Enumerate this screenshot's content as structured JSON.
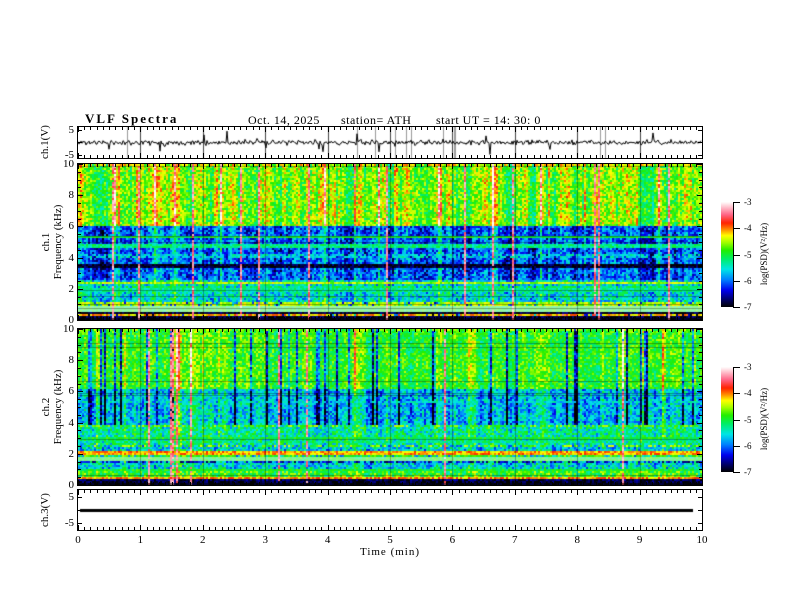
{
  "title": {
    "main": "VLF  Spectra",
    "date": "Oct. 14, 2025",
    "station": "station= ATH",
    "start_ut": "start UT =  14: 30: 0"
  },
  "x_axis": {
    "label": "Time  (min)",
    "range": [
      0,
      10
    ],
    "major_ticks": [
      "0",
      "1",
      "2",
      "3",
      "4",
      "5",
      "6",
      "7",
      "8",
      "9",
      "10"
    ],
    "minor_step": 0.1
  },
  "panels": {
    "wave1": {
      "ylabel": "ch.1(V)",
      "ytick_top": "5",
      "ytick_bottom": "-5",
      "yrange": [
        -5,
        5
      ]
    },
    "spec1": {
      "ylabel_ch": "ch.1",
      "ylabel_freq": "Frequency  (kHz)",
      "yticks": [
        "0",
        "2",
        "4",
        "6",
        "8",
        "10"
      ],
      "yrange": [
        0,
        10
      ]
    },
    "spec2": {
      "ylabel_ch": "ch.2",
      "ylabel_freq": "Frequency  (kHz)",
      "yticks": [
        "0",
        "2",
        "4",
        "6",
        "8",
        "10"
      ],
      "yrange": [
        0,
        10
      ]
    },
    "wave3": {
      "ylabel": "ch.3(V)",
      "ytick_top": "5",
      "ytick_bottom": "-5",
      "yrange": [
        -5,
        5
      ],
      "value": 0
    }
  },
  "colorbar": {
    "label": "log(PSD)(V²/Hz)",
    "ticks": [
      "-3",
      "-4",
      "-5",
      "-6",
      "-7"
    ],
    "range": [
      -7,
      -3
    ],
    "stops": [
      [
        0.0,
        "#000000"
      ],
      [
        0.07,
        "#000066"
      ],
      [
        0.16,
        "#0000ee"
      ],
      [
        0.26,
        "#0080ff"
      ],
      [
        0.36,
        "#00e6e6"
      ],
      [
        0.46,
        "#00ee66"
      ],
      [
        0.54,
        "#22ee00"
      ],
      [
        0.62,
        "#aaff00"
      ],
      [
        0.68,
        "#ffff00"
      ],
      [
        0.74,
        "#ff8800"
      ],
      [
        0.8,
        "#ff2200"
      ],
      [
        0.88,
        "#ff6688"
      ],
      [
        0.95,
        "#ffc0cc"
      ],
      [
        1.0,
        "#ffffff"
      ]
    ]
  },
  "chart_data": [
    {
      "type": "line",
      "name": "ch.1 voltage waveform",
      "xlabel": "Time (min)",
      "x_range": [
        0,
        10
      ],
      "ylabel": "ch.1(V)",
      "y_range": [
        -5,
        5
      ],
      "description": "broadband noise of roughly ±1 V around 0 V with impulsive sferic spikes reaching ±5 V across the full 10 minutes",
      "gen": {
        "seed": 11,
        "std": 0.7,
        "spike_prob": 0.028,
        "spike_amp_min": 1.5,
        "spike_amp_span": 3.2,
        "gray_lines": 12
      }
    },
    {
      "type": "heatmap",
      "name": "ch.1 VLF spectrogram",
      "xlabel": "Time (min)",
      "x_range": [
        0,
        10
      ],
      "ylabel": "ch.1 Frequency (kHz)",
      "y_range": [
        0,
        10
      ],
      "z_label": "log(PSD)(V²/Hz)",
      "z_range": [
        -7,
        -3
      ],
      "description": "green/yellow band 6-10 kHz with vertical sferic streaks and occasional red impulses; dark blue quiet band 2.6-6 kHz; cyan band 1-2.6 kHz; pale gray-green band near 0.75 kHz; dark speckled band below 0.5 kHz with bright horizontal interference lines",
      "gen": {
        "seed": 7,
        "red_col_count": 13,
        "red_level": -3.4,
        "dark_col_prob": 0,
        "bands": [
          {
            "f": [
              6.0,
              10
            ],
            "base": -5.6,
            "colGain": 1.9,
            "noise": 0.45
          },
          {
            "f": [
              2.6,
              6.0
            ],
            "base": -6.9,
            "colGain": 1.6,
            "noise": 0.5
          },
          {
            "f": [
              1.1,
              2.6
            ],
            "base": -6.1,
            "colGain": 1.1,
            "noise": 0.55
          },
          {
            "f": [
              0.5,
              1.1
            ],
            "base": -6.3,
            "colGain": 0.7,
            "noise": 0.7
          },
          {
            "f": [
              0.0,
              0.5
            ],
            "base": -6.6,
            "colGain": 0.3,
            "noise": 1.1,
            "sparkle": 0.1
          }
        ],
        "lines": [
          {
            "f": 9.93,
            "level": -4.2,
            "density": 0.5
          },
          {
            "f": 5.3,
            "level": -5.0
          },
          {
            "f": 4.75,
            "level": -5.25
          },
          {
            "f": 4.1,
            "level": -5.5,
            "density": 0.6
          },
          {
            "f": 3.45,
            "level": -6.9
          },
          {
            "f": 2.4,
            "level": -4.5
          },
          {
            "f": 2.15,
            "level": -5.1,
            "density": 0.7
          },
          {
            "f": 1.9,
            "level": -5.3
          },
          {
            "f": 1.05,
            "level": -4.5,
            "density": 0.8
          },
          {
            "f": 0.95,
            "level": -6.8
          },
          {
            "f": 0.75,
            "level": -5.0,
            "w": 0.22,
            "pale": 0.55
          },
          {
            "f": 0.45,
            "level": -6.9
          },
          {
            "f": 0.3,
            "level": -4.15,
            "density": 0.8
          },
          {
            "f": 0.12,
            "level": -6.9
          }
        ],
        "scanlines": 7
      }
    },
    {
      "type": "heatmap",
      "name": "ch.2 VLF spectrogram",
      "xlabel": "Time (min)",
      "x_range": [
        0,
        10
      ],
      "ylabel": "ch.2 Frequency (kHz)",
      "y_range": [
        0,
        10
      ],
      "z_label": "log(PSD)(V²/Hz)",
      "z_range": [
        -7,
        -3
      ],
      "description": "green band 6-10 kHz with dark-blue vertical streaks; blue band 4-6 kHz; cyan/green speckle below 4 kHz; strong orange interference lines near 2.05 and 0.45 kHz; pale band near 1.7 kHz; dark speckled band below 0.5 kHz",
      "gen": {
        "seed": 21,
        "red_col_count": 9,
        "red_level": -3.4,
        "dark_col_prob": 0.16,
        "bands": [
          {
            "f": [
              6.2,
              10
            ],
            "base": -5.4,
            "colGain": 1.1,
            "noise": 0.4,
            "darkStreak": 1
          },
          {
            "f": [
              3.9,
              6.2
            ],
            "base": -6.4,
            "colGain": 1.5,
            "noise": 0.5,
            "darkStreak": 1
          },
          {
            "f": [
              2.6,
              3.9
            ],
            "base": -5.8,
            "colGain": 1.0,
            "noise": 0.55
          },
          {
            "f": [
              1.0,
              2.6
            ],
            "base": -6.0,
            "colGain": 0.9,
            "noise": 0.6
          },
          {
            "f": [
              0.5,
              1.0
            ],
            "base": -5.2,
            "colGain": 0.6,
            "noise": 0.5
          },
          {
            "f": [
              0.0,
              0.5
            ],
            "base": -6.4,
            "colGain": 0.3,
            "noise": 1.1,
            "sparkle": 0.12
          }
        ],
        "lines": [
          {
            "f": 9.93,
            "level": -4.6,
            "density": 0.35
          },
          {
            "f": 5.3,
            "level": -5.5,
            "density": 0.6
          },
          {
            "f": 3.8,
            "level": -4.7,
            "density": 0.45
          },
          {
            "f": 3.05,
            "level": -5.0
          },
          {
            "f": 2.8,
            "level": -5.2,
            "density": 0.6
          },
          {
            "f": 2.5,
            "level": -4.6,
            "density": 0.4
          },
          {
            "f": 2.05,
            "level": -4.1,
            "w": 0.1
          },
          {
            "f": 1.9,
            "level": -4.8,
            "density": 0.6
          },
          {
            "f": 1.7,
            "level": -5.0,
            "w": 0.1,
            "pale": 0.45
          },
          {
            "f": 1.45,
            "level": -6.5,
            "density": 0.5
          },
          {
            "f": 0.95,
            "level": -5.0
          },
          {
            "f": 0.45,
            "level": -4.05,
            "w": 0.1
          },
          {
            "f": 0.3,
            "level": -6.8
          },
          {
            "f": 0.12,
            "level": -6.9
          }
        ],
        "scanlines": 7
      }
    },
    {
      "type": "line",
      "name": "ch.3 voltage waveform",
      "xlabel": "Time (min)",
      "x_range": [
        0,
        10
      ],
      "ylabel": "ch.3(V)",
      "y_range": [
        -5,
        5
      ],
      "description": "flat constant 0 V trace (thick black line) from 0 to ~9.85 min",
      "constant": 0
    }
  ]
}
